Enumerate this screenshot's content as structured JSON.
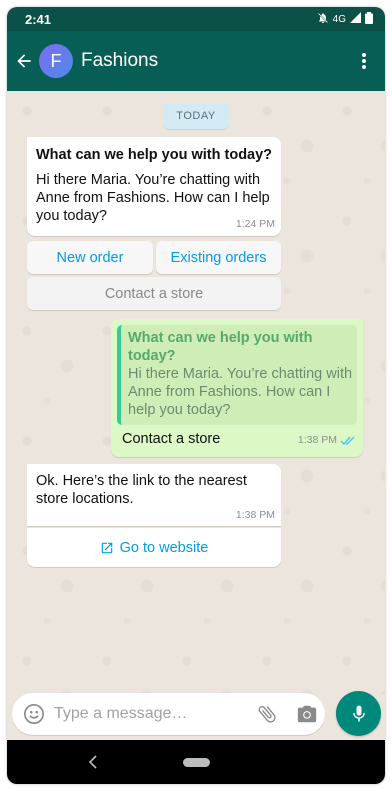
{
  "status_bar": {
    "time": "2:41",
    "network": "4G"
  },
  "header": {
    "avatar_letter": "F",
    "title": "Fashions"
  },
  "chat": {
    "date_chip": "TODAY",
    "incoming_1": {
      "title": "What can we help you with today?",
      "text": "Hi there Maria. You’re chatting with Anne from Fashions. How can I help you today?",
      "time": "1:24 PM"
    },
    "quick_replies": {
      "new_order": "New order",
      "existing_orders": "Existing orders",
      "contact_store": "Contact a store"
    },
    "outgoing": {
      "quote_title": "What can we help you with today?",
      "quote_text": "Hi there Maria. You’re chatting with Anne from Fashions. How can I help you today?",
      "text": "Contact a store",
      "time": "1:38 PM"
    },
    "incoming_2": {
      "text": "Ok. Here’s the link to the nearest store locations.",
      "time": "1:38 PM",
      "link_label": "Go to website"
    }
  },
  "composer": {
    "placeholder": "Type a message…"
  },
  "colors": {
    "header": "#075e54",
    "outgoing_bubble": "#dcf8c6",
    "accent": "#039be5",
    "fab": "#00897b"
  }
}
